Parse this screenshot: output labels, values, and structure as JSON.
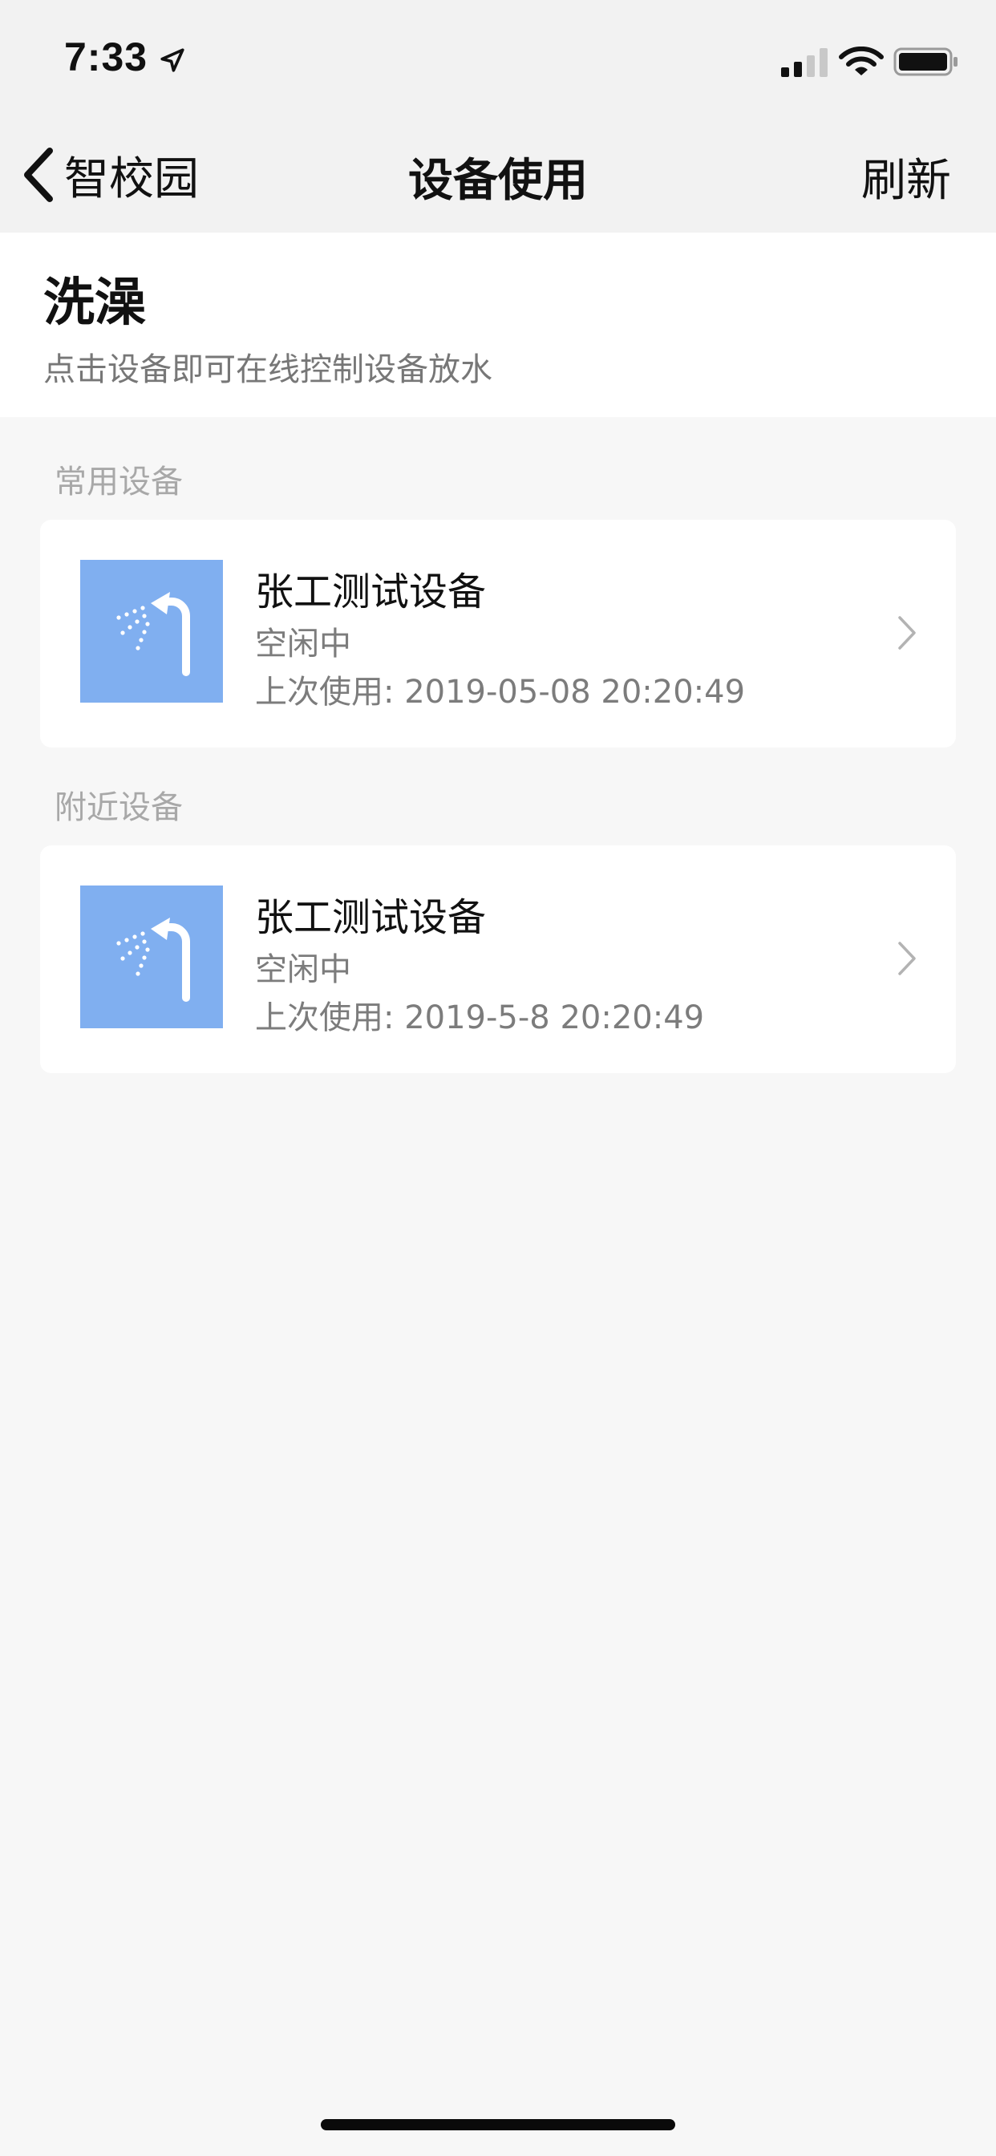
{
  "status_bar": {
    "time": "7:33",
    "location_icon": "location-arrow-icon",
    "cellular_icon": "cellular-signal-icon",
    "wifi_icon": "wifi-icon",
    "battery_icon": "battery-icon"
  },
  "nav": {
    "back_label": "智校园",
    "title": "设备使用",
    "refresh_label": "刷新"
  },
  "header": {
    "title": "洗澡",
    "subtitle": "点击设备即可在线控制设备放水"
  },
  "sections": {
    "common_label": "常用设备",
    "nearby_label": "附近设备"
  },
  "devices": {
    "common": [
      {
        "name": "张工测试设备",
        "status": "空闲中",
        "last_used": "上次使用: 2019-05-08 20:20:49",
        "icon": "shower-icon"
      }
    ],
    "nearby": [
      {
        "name": "张工测试设备",
        "status": "空闲中",
        "last_used": "上次使用: 2019-5-8 20:20:49",
        "icon": "shower-icon"
      }
    ]
  },
  "colors": {
    "thumb_bg": "#80aff0",
    "page_bg": "#f7f7f7",
    "nav_bg": "#f2f2f2",
    "secondary_text": "#7c7c7c",
    "section_label": "#a8a8a8"
  }
}
